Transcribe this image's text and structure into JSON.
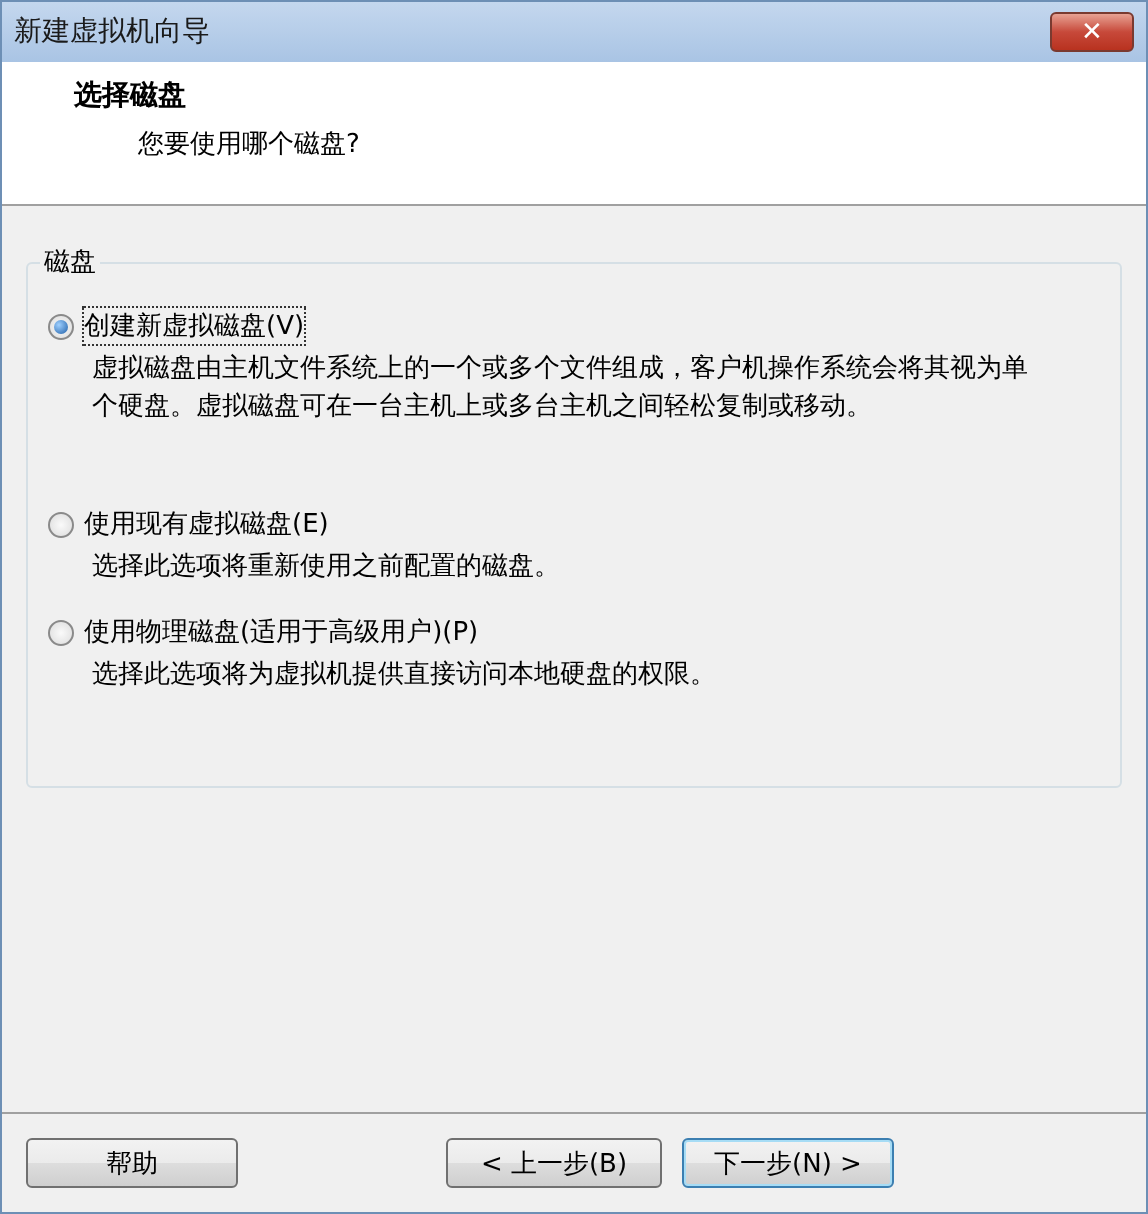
{
  "window": {
    "title": "新建虚拟机向导",
    "close": "✕"
  },
  "header": {
    "title": "选择磁盘",
    "subtitle": "您要使用哪个磁盘?"
  },
  "group": {
    "label": "磁盘",
    "options": [
      {
        "label": "创建新虚拟磁盘(V)",
        "description": "虚拟磁盘由主机文件系统上的一个或多个文件组成，客户机操作系统会将其视为单个硬盘。虚拟磁盘可在一台主机上或多台主机之间轻松复制或移动。",
        "selected": true
      },
      {
        "label": "使用现有虚拟磁盘(E)",
        "description": "选择此选项将重新使用之前配置的磁盘。",
        "selected": false
      },
      {
        "label": "使用物理磁盘(适用于高级用户)(P)",
        "description": "选择此选项将为虚拟机提供直接访问本地硬盘的权限。",
        "selected": false
      }
    ]
  },
  "buttons": [
    {
      "label": "帮助",
      "kind": "help"
    },
    {
      "label": "< 上一步(B)",
      "kind": "back"
    },
    {
      "label": "下一步(N) >",
      "kind": "default"
    }
  ]
}
